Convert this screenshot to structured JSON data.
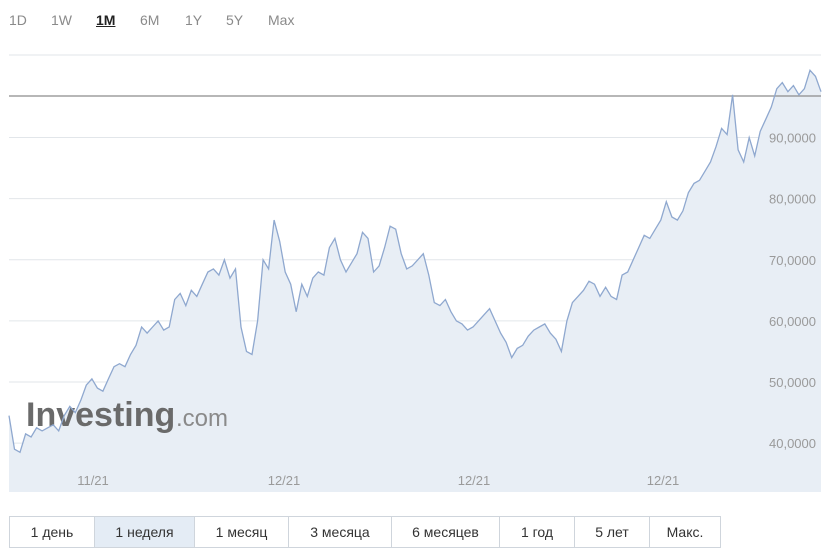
{
  "range_tabs": {
    "items": [
      {
        "label": "1D",
        "active": false
      },
      {
        "label": "1W",
        "active": false
      },
      {
        "label": "1M",
        "active": true
      },
      {
        "label": "6M",
        "active": false
      },
      {
        "label": "1Y",
        "active": false
      },
      {
        "label": "5Y",
        "active": false
      },
      {
        "label": "Max",
        "active": false
      }
    ]
  },
  "watermark": {
    "brand": "Investing",
    "suffix": ".com"
  },
  "period_tabs": {
    "items": [
      {
        "label": "1 день",
        "active": false
      },
      {
        "label": "1 неделя",
        "active": true
      },
      {
        "label": "1 месяц",
        "active": false
      },
      {
        "label": "3 месяца",
        "active": false
      },
      {
        "label": "6 месяцев",
        "active": false
      },
      {
        "label": "1 год",
        "active": false
      },
      {
        "label": "5 лет",
        "active": false
      },
      {
        "label": "Макс.",
        "active": false
      }
    ]
  },
  "colors": {
    "line": "#8fa8cf",
    "fill": "#e8eef5",
    "grid": "#e2e6ea",
    "axis_text": "#9a9a9a",
    "reference_line": "#8c8c8c"
  },
  "chart_data": {
    "type": "area",
    "title": "",
    "xlabel": "",
    "ylabel": "",
    "x_tick_labels": [
      "11/21",
      "12/21",
      "12/21",
      "12/21"
    ],
    "y_tick_labels": [
      "40,0000",
      "50,0000",
      "60,0000",
      "70,0000",
      "80,0000",
      "90,0000"
    ],
    "y_ticks": [
      40,
      50,
      60,
      70,
      80,
      90
    ],
    "ylim": [
      32,
      104
    ],
    "grid": true,
    "reference_line_value": 96.8,
    "series": [
      {
        "values": [
          44.5,
          39,
          38.5,
          41.5,
          41,
          42.5,
          42,
          42.5,
          43,
          42,
          44.5,
          46,
          45,
          47,
          49.5,
          50.5,
          49,
          48.5,
          50.5,
          52.5,
          53,
          52.5,
          54.5,
          56,
          59,
          58,
          59,
          60,
          58.5,
          59,
          63.5,
          64.5,
          62.5,
          65,
          64,
          66,
          68,
          68.5,
          67.5,
          70,
          67,
          68.5,
          59,
          55,
          54.5,
          60,
          70,
          68.5,
          76.5,
          73,
          68,
          66,
          61.5,
          66,
          64,
          67,
          68,
          67.5,
          72,
          73.5,
          70,
          68,
          69.5,
          71,
          74.5,
          73.5,
          68,
          69,
          72,
          75.5,
          75,
          71,
          68.5,
          69,
          70,
          71,
          67.5,
          63,
          62.5,
          63.5,
          61.5,
          60,
          59.5,
          58.5,
          59,
          60,
          61,
          62,
          60,
          58,
          56.5,
          54,
          55.5,
          56,
          57.5,
          58.5,
          59,
          59.5,
          58,
          57,
          55,
          60,
          63,
          64,
          65,
          66.5,
          66,
          64,
          65.5,
          64,
          63.5,
          67.5,
          68,
          70,
          72,
          74,
          73.5,
          75,
          76.5,
          79.5,
          77,
          76.5,
          78,
          81,
          82.5,
          83,
          84.5,
          86,
          88.5,
          91.5,
          90.5,
          97,
          88,
          86,
          90,
          87,
          91,
          93,
          95,
          98,
          99,
          97.5,
          98.5,
          97,
          98,
          101,
          100,
          97.5
        ]
      }
    ]
  }
}
